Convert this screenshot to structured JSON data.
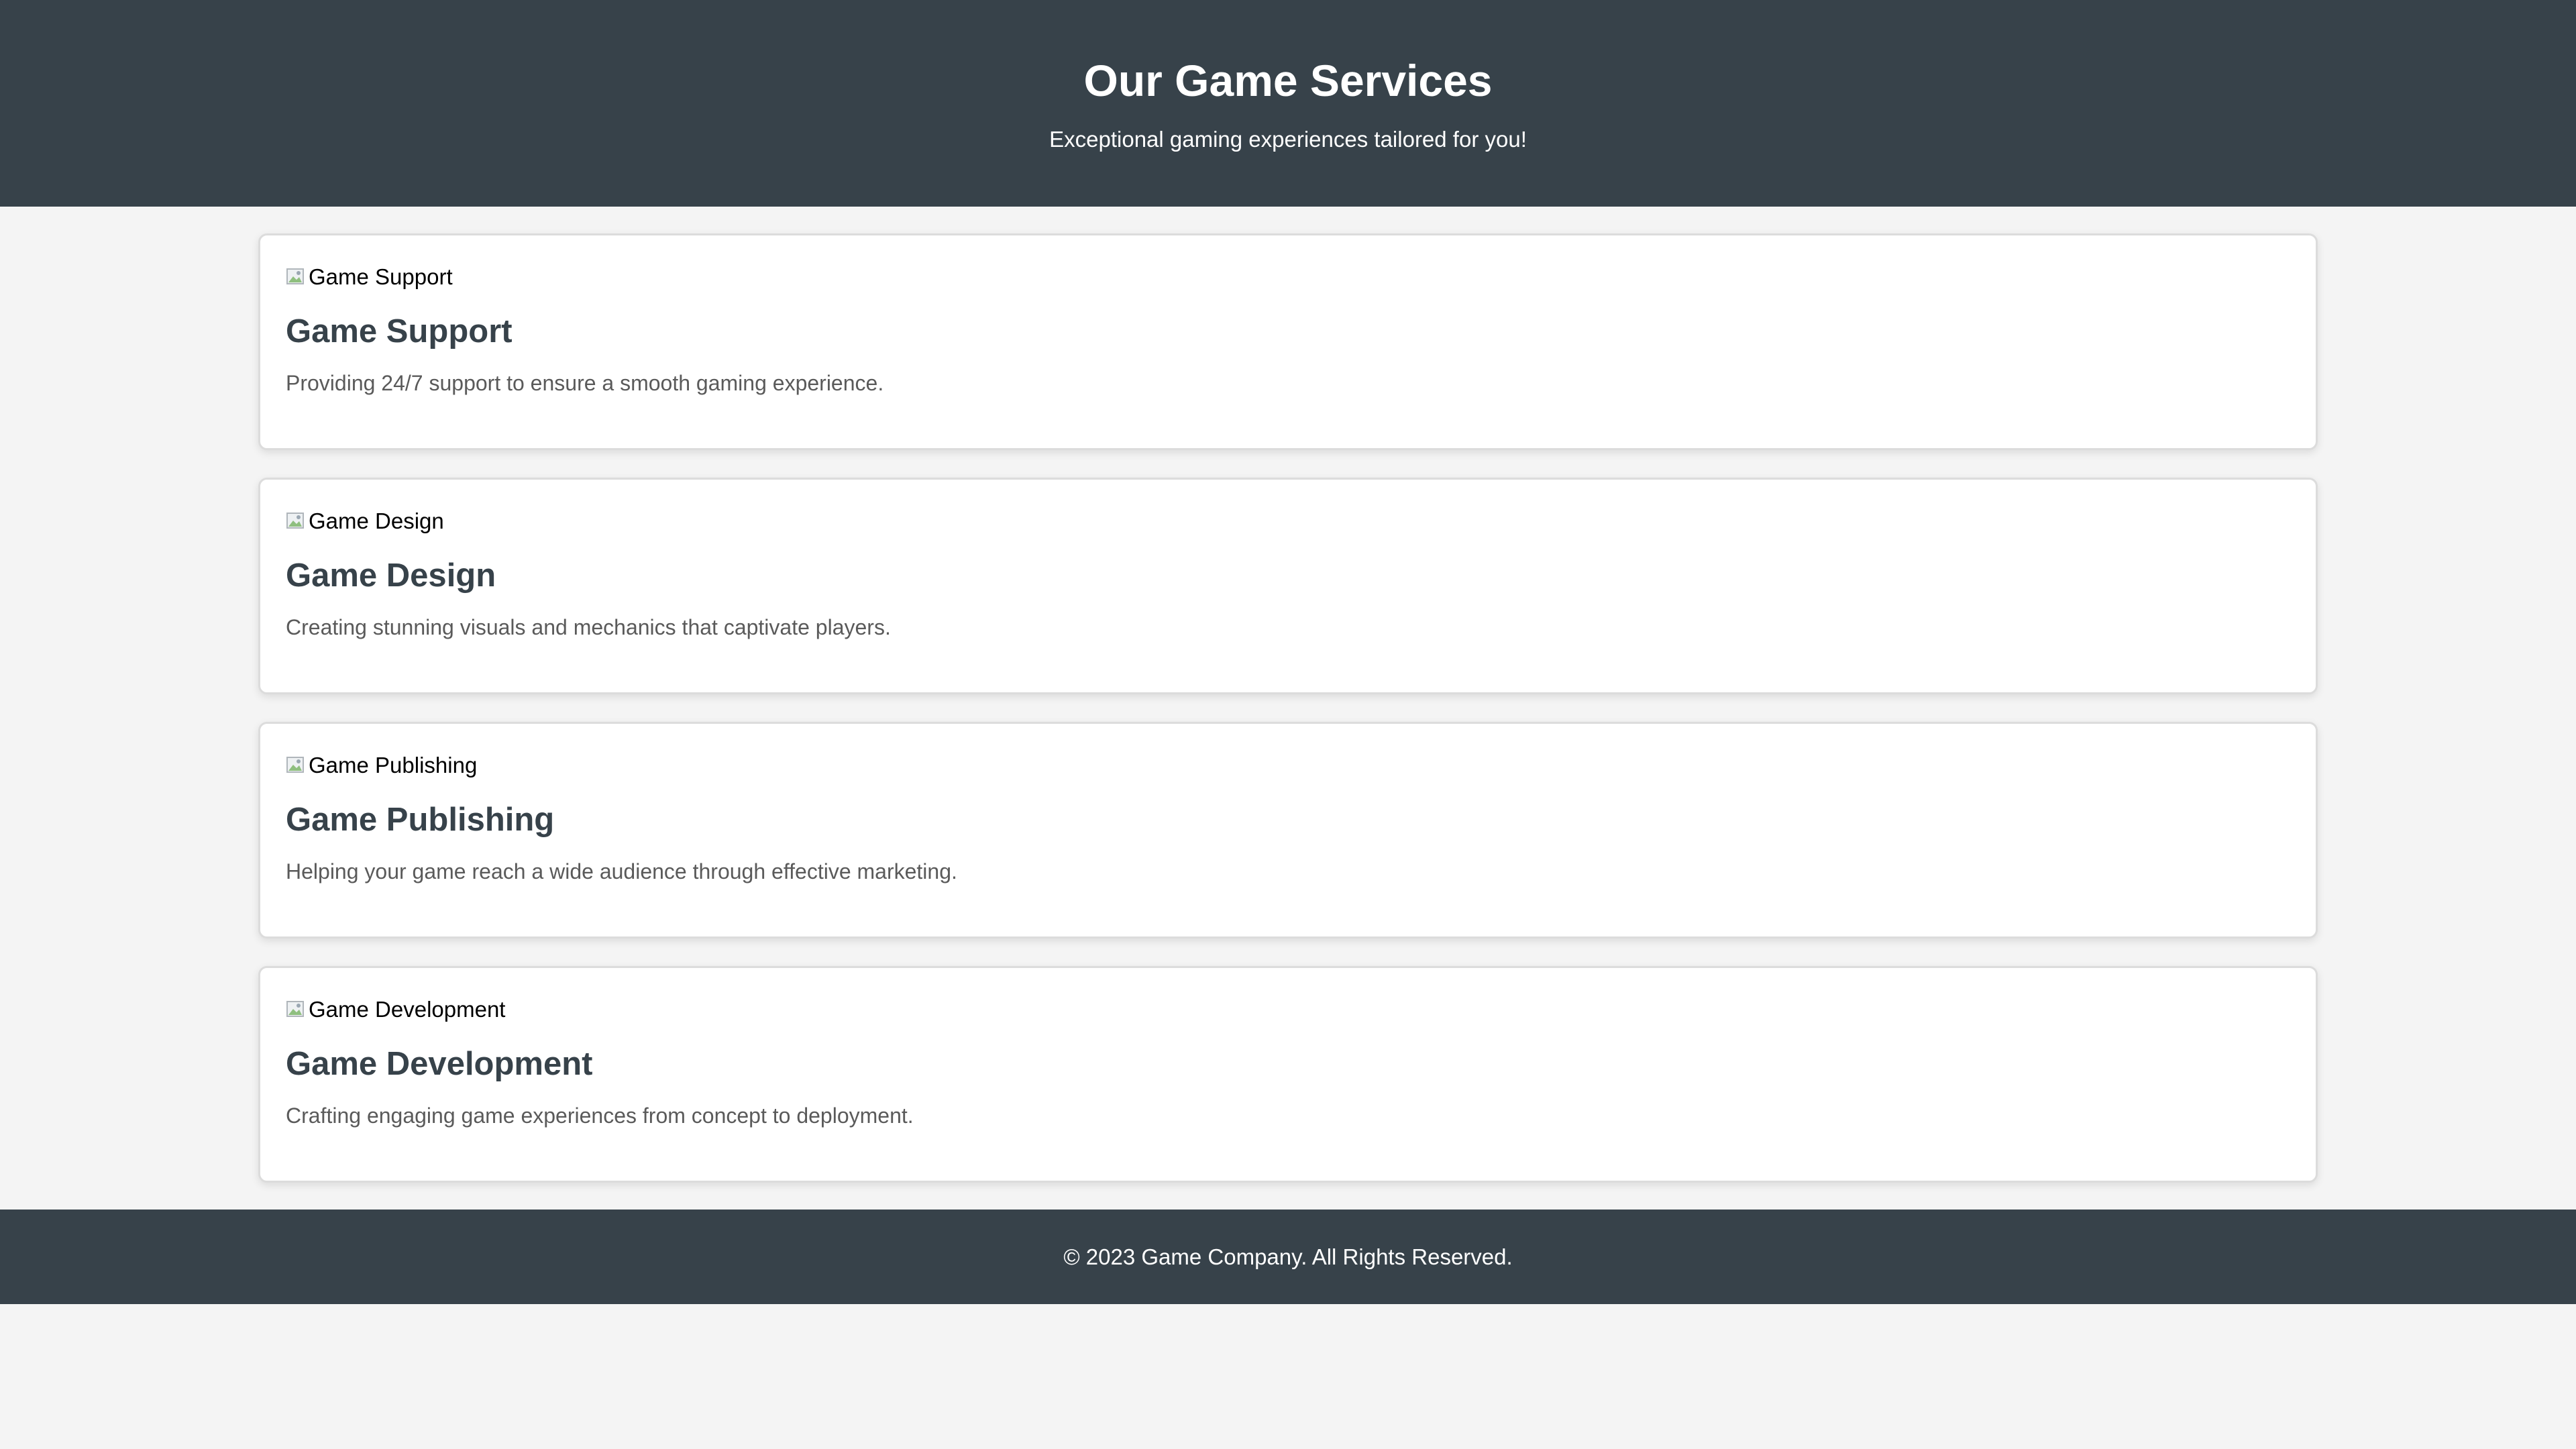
{
  "header": {
    "title": "Our Game Services",
    "subtitle": "Exceptional gaming experiences tailored for you!"
  },
  "services": [
    {
      "image_alt": "Game Support",
      "title": "Game Support",
      "description": "Providing 24/7 support to ensure a smooth gaming experience."
    },
    {
      "image_alt": "Game Design",
      "title": "Game Design",
      "description": "Creating stunning visuals and mechanics that captivate players."
    },
    {
      "image_alt": "Game Publishing",
      "title": "Game Publishing",
      "description": "Helping your game reach a wide audience through effective marketing."
    },
    {
      "image_alt": "Game Development",
      "title": "Game Development",
      "description": "Crafting engaging game experiences from concept to deployment."
    }
  ],
  "footer": {
    "copyright": "© 2023 Game Company. All Rights Reserved."
  },
  "colors": {
    "header_bg": "#37424a",
    "page_bg": "#f4f4f4",
    "card_bg": "#ffffff",
    "heading_text": "#37424a",
    "body_text": "#5a5a5a"
  }
}
